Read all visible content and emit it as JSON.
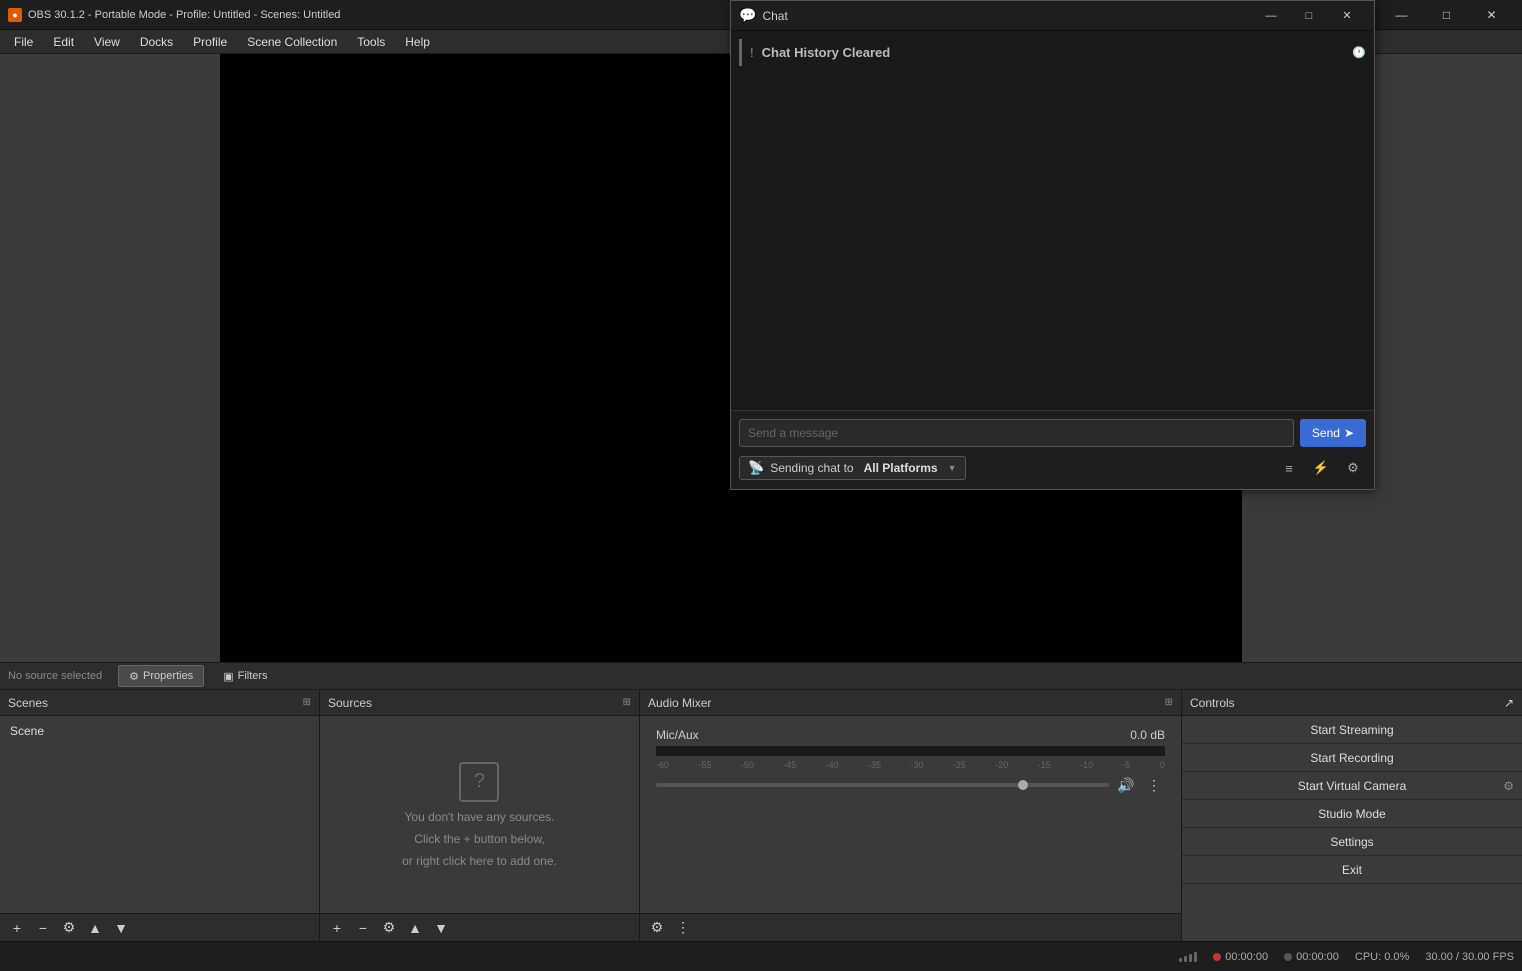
{
  "titleBar": {
    "title": "OBS 30.1.2 - Portable Mode - Profile: Untitled - Scenes: Untitled",
    "icon": "●",
    "minimize": "—",
    "maximize": "□",
    "close": "✕"
  },
  "menuBar": {
    "items": [
      "File",
      "Edit",
      "View",
      "Docks",
      "Profile",
      "Scene Collection",
      "Tools",
      "Help"
    ]
  },
  "preview": {
    "noSource": "No source selected"
  },
  "tabs": {
    "properties": "Properties",
    "filters": "Filters"
  },
  "scenes": {
    "header": "Scenes",
    "items": [
      {
        "name": "Scene"
      }
    ],
    "addLabel": "+",
    "removeLabel": "−",
    "filterLabel": "⚙",
    "upLabel": "▲",
    "downLabel": "▼"
  },
  "sources": {
    "header": "Sources",
    "emptyText": "You don't have any sources.",
    "emptyLine2": "Click the + button below,",
    "emptyLine3": "or right click here to add one.",
    "addLabel": "+",
    "removeLabel": "−",
    "filterLabel": "⚙",
    "upLabel": "▲",
    "downLabel": "▼"
  },
  "audioMixer": {
    "header": "Audio Mixer",
    "tracks": [
      {
        "name": "Mic/Aux",
        "db": "0.0 dB",
        "scaleLabels": [
          "-60",
          "-55",
          "-50",
          "-45",
          "-40",
          "-35",
          "-30",
          "-25",
          "-20",
          "-15",
          "-10",
          "-5",
          "0"
        ]
      }
    ],
    "settingsLabel": "⚙",
    "menuLabel": "⋮"
  },
  "controls": {
    "header": "Controls",
    "collapseIcon": "↗",
    "buttons": {
      "startStreaming": "Start Streaming",
      "startRecording": "Start Recording",
      "startVirtualCamera": "Start Virtual Camera",
      "studioMode": "Studio Mode",
      "settings": "Settings",
      "exit": "Exit"
    },
    "settingsIcon": "⚙"
  },
  "chat": {
    "title": "Chat",
    "icon": "💬",
    "minimize": "—",
    "maximize": "□",
    "close": "✕",
    "historyCleared": "Chat History Cleared",
    "historyIcon": "!",
    "historyTimeIcon": "🕐",
    "inputPlaceholder": "Send a message",
    "sendLabel": "Send",
    "sendIcon": "➤",
    "platformText": "Sending chat to",
    "platformBold": "All Platforms",
    "platformIcon": "📡",
    "platformArrow": "▼",
    "actions": {
      "list": "≡",
      "filter": "⚡",
      "settings": "⚙"
    }
  },
  "statusBar": {
    "networkBars": 3,
    "recTime": "00:00:00",
    "streamTime": "00:00:00",
    "cpu": "CPU: 0.0%",
    "fps": "30.00 / 30.00 FPS"
  }
}
